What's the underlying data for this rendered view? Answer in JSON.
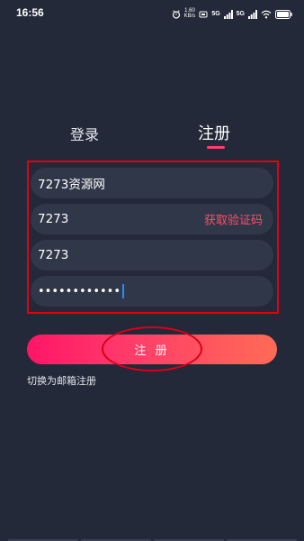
{
  "status_bar": {
    "time": "16:56",
    "speed_value": "1.60",
    "speed_unit": "KB/s",
    "net1": "5G",
    "net2": "5G",
    "wifi": "wifi-icon",
    "battery": "battery-icon"
  },
  "tabs": [
    {
      "label": "登录",
      "active": false
    },
    {
      "label": "注册",
      "active": true
    }
  ],
  "form": {
    "username_value": "7273资源网",
    "phone_value": "7273",
    "get_code_label": "获取验证码",
    "code_value": "7273",
    "password_value": "••••••••••••"
  },
  "register_button_label": "注 册",
  "switch_email_label": "切换为邮箱注册",
  "colors": {
    "background": "#232939",
    "field": "#303748",
    "accent": "#ff3d6e",
    "highlight": "#e00012"
  }
}
